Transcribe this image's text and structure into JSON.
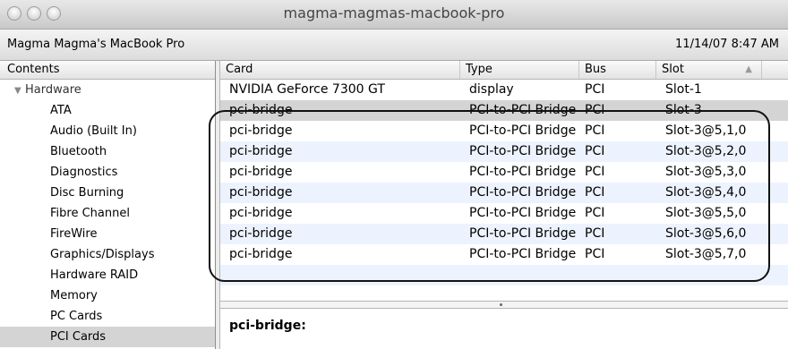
{
  "window": {
    "title": "magma-magmas-macbook-pro"
  },
  "info": {
    "machine_name": "Magma Magma's MacBook Pro",
    "datetime": "11/14/07 8:47 AM"
  },
  "sidebar": {
    "header": "Contents",
    "section": {
      "label": "Hardware",
      "expanded": true
    },
    "items": [
      {
        "label": "ATA"
      },
      {
        "label": "Audio (Built In)"
      },
      {
        "label": "Bluetooth"
      },
      {
        "label": "Diagnostics"
      },
      {
        "label": "Disc Burning"
      },
      {
        "label": "Fibre Channel"
      },
      {
        "label": "FireWire"
      },
      {
        "label": "Graphics/Displays"
      },
      {
        "label": "Hardware RAID"
      },
      {
        "label": "Memory"
      },
      {
        "label": "PC Cards"
      },
      {
        "label": "PCI Cards",
        "selected": true
      }
    ]
  },
  "table": {
    "columns": [
      "Card",
      "Type",
      "Bus",
      "Slot"
    ],
    "sort_indicator": "▲",
    "rows": [
      {
        "card": "NVIDIA GeForce 7300 GT",
        "type": "display",
        "bus": "PCI",
        "slot": "Slot-1"
      },
      {
        "card": "pci-bridge",
        "type": "PCI-to-PCI Bridge",
        "bus": "PCI",
        "slot": "Slot-3",
        "selected": true
      },
      {
        "card": "pci-bridge",
        "type": "PCI-to-PCI Bridge",
        "bus": "PCI",
        "slot": "Slot-3@5,1,0"
      },
      {
        "card": "pci-bridge",
        "type": "PCI-to-PCI Bridge",
        "bus": "PCI",
        "slot": "Slot-3@5,2,0"
      },
      {
        "card": "pci-bridge",
        "type": "PCI-to-PCI Bridge",
        "bus": "PCI",
        "slot": "Slot-3@5,3,0"
      },
      {
        "card": "pci-bridge",
        "type": "PCI-to-PCI Bridge",
        "bus": "PCI",
        "slot": "Slot-3@5,4,0"
      },
      {
        "card": "pci-bridge",
        "type": "PCI-to-PCI Bridge",
        "bus": "PCI",
        "slot": "Slot-3@5,5,0"
      },
      {
        "card": "pci-bridge",
        "type": "PCI-to-PCI Bridge",
        "bus": "PCI",
        "slot": "Slot-3@5,6,0"
      },
      {
        "card": "pci-bridge",
        "type": "PCI-to-PCI Bridge",
        "bus": "PCI",
        "slot": "Slot-3@5,7,0"
      }
    ]
  },
  "detail": {
    "title": "pci-bridge:"
  },
  "colors": {
    "row_alt": "#edf3fe",
    "row_selected": "#d4d4d4",
    "annotation_border": "#111111"
  }
}
